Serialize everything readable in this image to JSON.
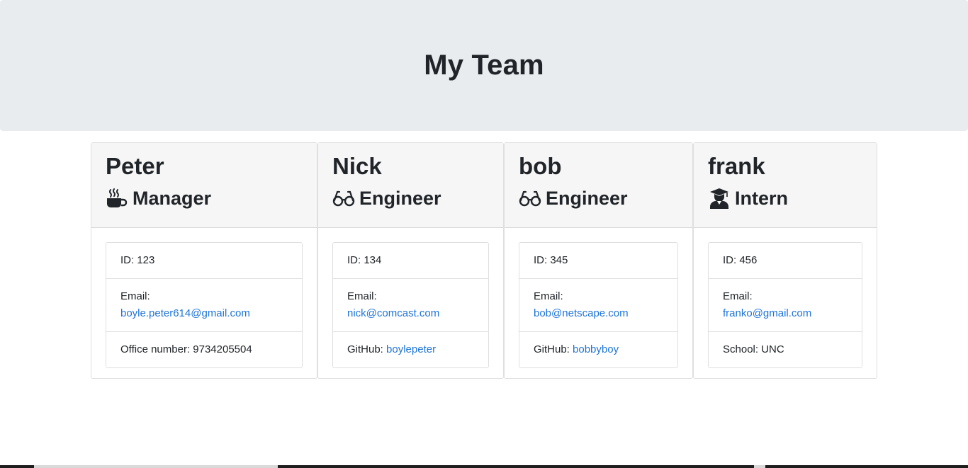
{
  "header": {
    "title": "My Team"
  },
  "cards": [
    {
      "name": "Peter",
      "role": "Manager",
      "icon": "coffee-icon",
      "id_text": "ID: 123",
      "email_label": "Email:",
      "email": "boyle.peter614@gmail.com",
      "extra_label": "Office number: ",
      "extra_value": "9734205504"
    },
    {
      "name": "Nick",
      "role": "Engineer",
      "icon": "glasses-icon",
      "id_text": "ID: 134",
      "email_label": "Email:",
      "email": "nick@comcast.com",
      "extra_label": "GitHub: ",
      "extra_value": "boylepeter"
    },
    {
      "name": "bob",
      "role": "Engineer",
      "icon": "glasses-icon",
      "id_text": "ID: 345",
      "email_label": "Email:",
      "email": "bob@netscape.com",
      "extra_label": "GitHub: ",
      "extra_value": "bobbyboy"
    },
    {
      "name": "frank",
      "role": "Intern",
      "icon": "graduate-icon",
      "id_text": "ID: 456",
      "email_label": "Email:",
      "email": "franko@gmail.com",
      "extra_label": "School: ",
      "extra_value": "UNC"
    }
  ],
  "colors": {
    "jumbotron_bg": "#e9ecef",
    "card_header_bg": "#f6f6f6",
    "link": "#1f74d9",
    "text": "#212529"
  }
}
